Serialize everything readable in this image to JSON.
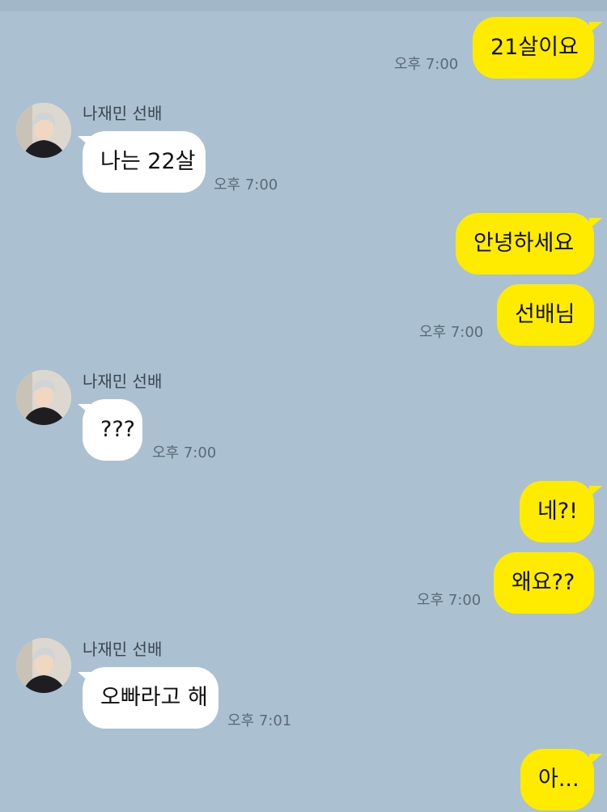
{
  "chat": {
    "partner_name": "나재민 선배",
    "messages": [
      {
        "from": "me",
        "text": "21살이요",
        "time": "오후 7:00"
      },
      {
        "from": "them",
        "text": "나는 22살",
        "time": "오후 7:00"
      },
      {
        "from": "me",
        "text": "안녕하세요",
        "time": ""
      },
      {
        "from": "me",
        "text": "선배님",
        "time": "오후 7:00"
      },
      {
        "from": "them",
        "text": "???",
        "time": "오후 7:00"
      },
      {
        "from": "me",
        "text": "네?!",
        "time": ""
      },
      {
        "from": "me",
        "text": "왜요??",
        "time": "오후 7:00"
      },
      {
        "from": "them",
        "text": "오빠라고 해",
        "time": "오후 7:01"
      },
      {
        "from": "me",
        "text": "아...",
        "time": ""
      }
    ]
  },
  "colors": {
    "background": "#abc1d1",
    "my_bubble": "#ffeb00",
    "partner_bubble": "#ffffff"
  },
  "icons": {
    "avatar": "profile-photo"
  }
}
